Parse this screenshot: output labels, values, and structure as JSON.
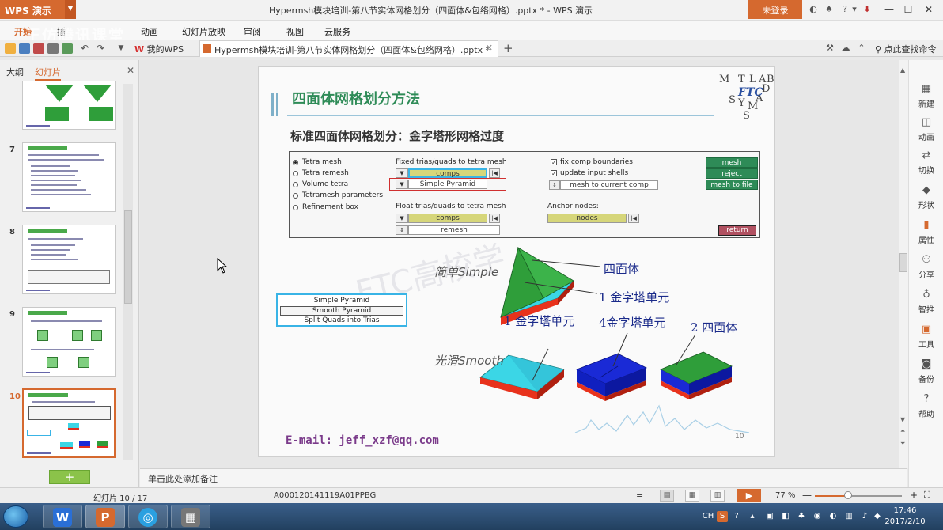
{
  "titlebar": {
    "app_label": "WPS 演示",
    "document_title": "Hypermsh模块培训-第八节实体网格划分（四面体&包络网格）.pptx * - WPS 演示",
    "login_label": "未登录"
  },
  "menu": {
    "items": [
      "开始",
      "插",
      "动画",
      "幻灯片放映",
      "审阅",
      "视图",
      "云服务"
    ],
    "overlay_text": "王仿腾讯课堂"
  },
  "tabs": {
    "mywps_label": "我的WPS",
    "doc_tab_label": "Hypermsh模块培训-第八节实体网格划分（四面体&包络网格）.pptx *",
    "search_label": "点此查找命令"
  },
  "left_panel": {
    "outline_tab": "大纲",
    "slides_tab": "幻灯片",
    "thumb_numbers": [
      "7",
      "8",
      "9",
      "10"
    ],
    "add_slide_label": "+"
  },
  "slide": {
    "title": "四面体网格划分方法",
    "subtitle": "标准四面体网格划分：金字塔形网格过度",
    "logo_letters": [
      "M",
      "T",
      "L",
      "A",
      "B",
      "D",
      "A",
      "S",
      "Y",
      "M",
      "S"
    ],
    "logo_center": "FTC",
    "form": {
      "radio_options": [
        "Tetra mesh",
        "Tetra remesh",
        "Volume tetra",
        "Tetramesh parameters",
        "Refinement box"
      ],
      "selected_radio": "Tetra mesh",
      "fixed_label": "Fixed trias/quads to tetra mesh",
      "fixed_comps": "comps",
      "pyramid_option": "Simple Pyramid",
      "float_label": "Float trias/quads to tetra mesh",
      "float_comps": "comps",
      "remesh_label": "remesh",
      "check_fix": "fix comp boundaries",
      "check_update": "update input shells",
      "mesh_to_current": "mesh to current comp",
      "anchor_label": "Anchor nodes:",
      "anchor_nodes": "nodes",
      "btn_mesh": "mesh",
      "btn_reject": "reject",
      "btn_mesh_to_file": "mesh to file",
      "btn_return": "return"
    },
    "popup_items": [
      "Simple Pyramid",
      "Smooth Pyramid",
      "Split Quads into Trias"
    ],
    "label_simple": "简单Simple",
    "label_smooth": "光滑Smooth",
    "label_tetra": "四面体",
    "label_pyramid1_top": "1 金字塔单元",
    "label_pyramid1_left": "1 金字塔单元",
    "label_pyramid4": "4金字塔单元",
    "label_tetra2": "2 四面体",
    "watermark": "FTC高校学",
    "email": "E-mail: jeff_xzf@qq.com",
    "page_number": "10"
  },
  "right_sidebar": {
    "items": [
      "新建",
      "动画",
      "切换",
      "形状",
      "属性",
      "分享",
      "智推",
      "工具",
      "备份",
      "帮助"
    ]
  },
  "notes": {
    "placeholder": "单击此处添加备注"
  },
  "status": {
    "slide_counter": "幻灯片 10 / 17",
    "template_name": "A000120141119A01PPBG",
    "zoom": "77 %"
  },
  "taskbar": {
    "time": "17:46",
    "date": "2017/2/10",
    "lang": "CH"
  },
  "colors": {
    "accent": "#d5692f",
    "title_green": "#2e8b57",
    "label_blue": "#1a2a8a"
  }
}
